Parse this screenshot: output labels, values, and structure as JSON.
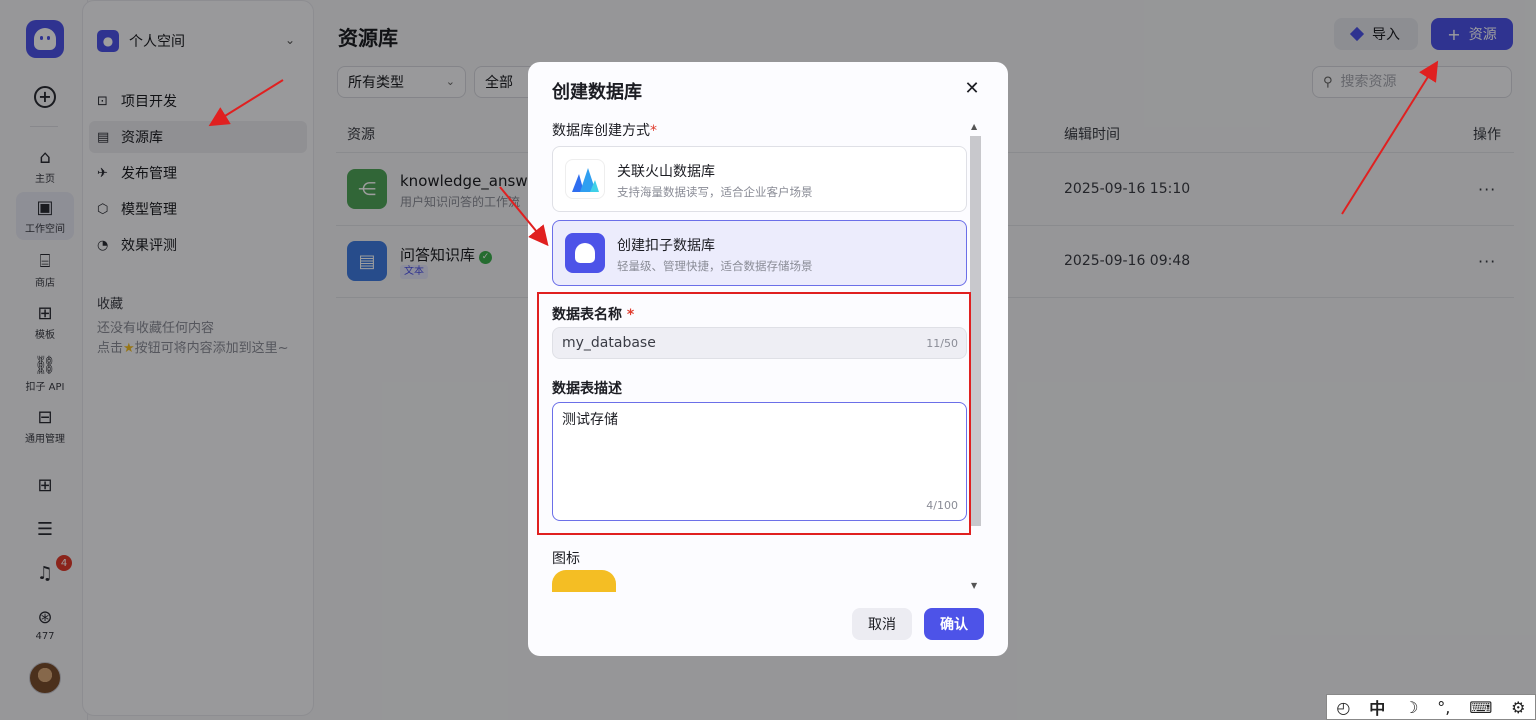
{
  "rail": {
    "items": [
      {
        "label": "主页",
        "icon": "home-icon",
        "glyph": "⌂"
      },
      {
        "label": "工作空间",
        "icon": "terminal-icon",
        "glyph": "▣"
      },
      {
        "label": "商店",
        "icon": "store-icon",
        "glyph": "⌸"
      },
      {
        "label": "模板",
        "icon": "template-icon",
        "glyph": "⊞"
      },
      {
        "label": "扣子 API",
        "icon": "api-icon",
        "glyph": "⛓"
      },
      {
        "label": "通用管理",
        "icon": "manage-icon",
        "glyph": "⊟"
      }
    ],
    "notification_count": "4",
    "points": "477"
  },
  "sidebar": {
    "space_label": "个人空间",
    "nav": [
      {
        "label": "项目开发",
        "icon": "project-icon",
        "glyph": "⊡"
      },
      {
        "label": "资源库",
        "icon": "library-icon",
        "glyph": "▤"
      },
      {
        "label": "发布管理",
        "icon": "rocket-icon",
        "glyph": "✈"
      },
      {
        "label": "模型管理",
        "icon": "model-icon",
        "glyph": "⬡"
      },
      {
        "label": "效果评测",
        "icon": "gauge-icon",
        "glyph": "◔"
      }
    ],
    "favorites_title": "收藏",
    "favorites_empty_line1": "还没有收藏任何内容",
    "favorites_empty_line2_before": "点击",
    "favorites_empty_line2_after": "按钮可将内容添加到这里~"
  },
  "main": {
    "title": "资源库",
    "import_label": "导入",
    "add_resource_label": "资源",
    "filter_type": "所有类型",
    "filter_scope": "全部",
    "search_placeholder": "搜索资源",
    "col_resource": "资源",
    "col_edit_time": "编辑时间",
    "col_action": "操作",
    "rows": [
      {
        "name": "knowledge_answer_",
        "desc": "用户知识问答的工作流",
        "time": "2025-09-16 15:10",
        "icon_color": "#4fa55a",
        "more": "···"
      },
      {
        "name": "问答知识库",
        "tag": "文本",
        "time": "2025-09-16 09:48",
        "icon_color": "#3f7be0",
        "more": "···"
      }
    ]
  },
  "modal": {
    "title": "创建数据库",
    "method_label": "数据库创建方式",
    "options": [
      {
        "title": "关联火山数据库",
        "desc": "支持海量数据读写，适合企业客户场景"
      },
      {
        "title": "创建扣子数据库",
        "desc": "轻量级、管理快捷，适合数据存储场景"
      }
    ],
    "name_label": "数据表名称",
    "name_value": "my_database",
    "name_counter": "11/50",
    "desc_label": "数据表描述",
    "desc_value": "测试存储",
    "desc_counter": "4/100",
    "icon_label": "图标",
    "cancel_label": "取消",
    "confirm_label": "确认"
  },
  "ime": {
    "mode": "中"
  },
  "colors": {
    "accent": "#4d53e8",
    "annotation": "#e02020"
  }
}
